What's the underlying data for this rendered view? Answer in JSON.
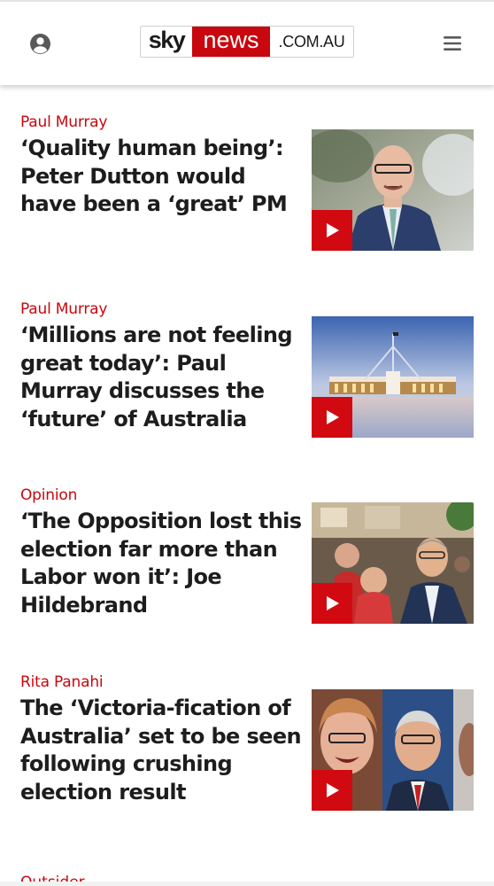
{
  "header": {
    "logo": {
      "part1": "sky",
      "part2": "news",
      "part3": ".COM.AU"
    },
    "account_icon": "account-circle-icon",
    "menu_icon": "hamburger-menu-icon"
  },
  "articles": [
    {
      "category": "Paul Murray",
      "headline": "‘Quality human being’: Peter Dutton would have been a ‘great’ PM"
    },
    {
      "category": "Paul Murray",
      "headline": "‘Millions are not feeling great today’: Paul Murray discusses the ‘future’ of Australia"
    },
    {
      "category": "Opinion",
      "headline": "‘The Opposition lost this election far more than Labor won it’: Joe Hildebrand"
    },
    {
      "category": "Rita Panahi",
      "headline": "The ‘Victoria-fication of Australia’ set to be seen following crushing election result"
    }
  ],
  "next_category_peek": "Outsider",
  "colors": {
    "brand_red": "#c8070e",
    "play_red": "#d10a11",
    "text": "#1d1d1d"
  }
}
